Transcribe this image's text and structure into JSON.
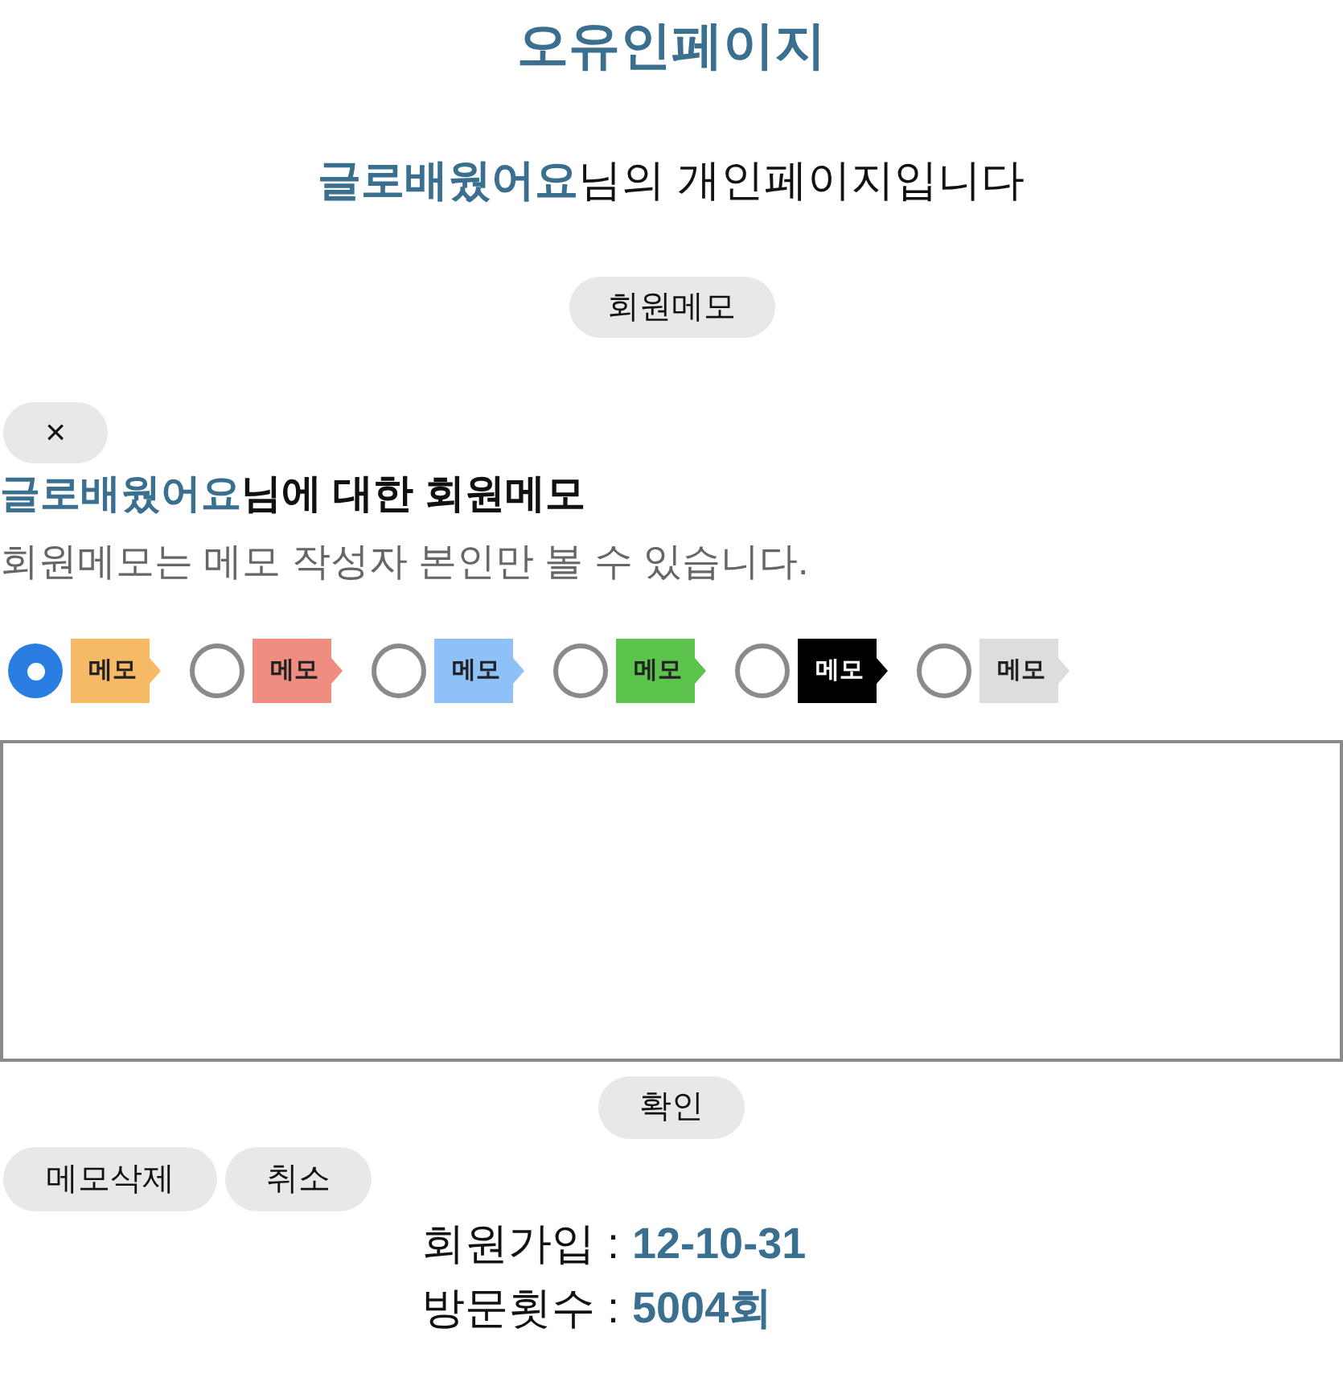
{
  "title": "오유인페이지",
  "greeting": {
    "name": "글로배웠어요",
    "suffix": "님의 개인페이지입니다"
  },
  "memo_button": "회원메모",
  "memo_panel": {
    "close": "×",
    "heading": {
      "name": "글로배웠어요",
      "suffix": "님에 대한 회원메모"
    },
    "notice": "회원메모는 메모 작성자 본인만 볼 수 있습니다.",
    "colors": [
      {
        "label": "메모",
        "color": "#f6b966",
        "selected": true
      },
      {
        "label": "메모",
        "color": "#ef8e80",
        "selected": false
      },
      {
        "label": "메모",
        "color": "#8ec1f7",
        "selected": false
      },
      {
        "label": "메모",
        "color": "#5cc44c",
        "selected": false
      },
      {
        "label": "메모",
        "color": "#000000",
        "selected": false
      },
      {
        "label": "메모",
        "color": "#dddddd",
        "selected": false
      }
    ],
    "confirm": "확인",
    "delete": "메모삭제",
    "cancel": "취소"
  },
  "stats": [
    {
      "label": "회원가입 :",
      "value": "12-10-31"
    },
    {
      "label": "방문횟수 :",
      "value": "5004회"
    }
  ]
}
